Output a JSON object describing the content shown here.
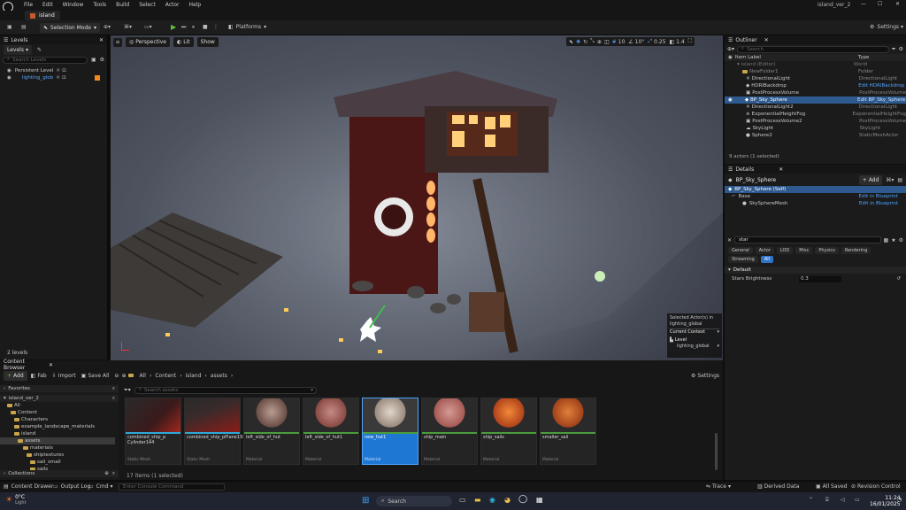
{
  "menu": {
    "items": [
      "File",
      "Edit",
      "Window",
      "Tools",
      "Build",
      "Select",
      "Actor",
      "Help"
    ],
    "project": "island_ver_2"
  },
  "tab": {
    "label": "island"
  },
  "toolbar": {
    "mode": "Selection Mode",
    "platforms": "Platforms",
    "settings": "Settings"
  },
  "levels": {
    "tab": "Levels",
    "dropdown": "Levels",
    "search_placeholder": "Search Levels",
    "items": [
      "Persistent Level",
      "lighting_glob"
    ],
    "count": "2 levels"
  },
  "viewport": {
    "perspective": "Perspective",
    "lit": "Lit",
    "show": "Show",
    "grid": "10",
    "angle": "10°",
    "scale": "0.25",
    "speed": "1.4",
    "overlay": {
      "line1": "Selected Actor(s) in",
      "line2": "lighting_global",
      "context": "Current Context",
      "level_label": "Level",
      "level_value": "lighting_global"
    }
  },
  "outliner": {
    "tab": "Outliner",
    "search_placeholder": "Search",
    "col_label": "Item Label",
    "col_type": "Type",
    "rows": [
      {
        "label": "island (Editor)",
        "type": "World"
      },
      {
        "label": "NewFolder1",
        "type": "Folder"
      },
      {
        "label": "DirectionalLight",
        "type": "DirectionalLight"
      },
      {
        "label": "HDRIBackdrop",
        "type": "Edit HDRIBackdrop"
      },
      {
        "label": "PostProcessVolume",
        "type": "PostProcessVolume"
      },
      {
        "label": "BP_Sky_Sphere",
        "type": "Edit BP_Sky_Sphere"
      },
      {
        "label": "DirectionalLight2",
        "type": "DirectionalLight"
      },
      {
        "label": "ExponentialHeightFog",
        "type": "ExponentialHeightFog"
      },
      {
        "label": "PostProcessVolume2",
        "type": "PostProcessVolume"
      },
      {
        "label": "SkyLight",
        "type": "SkyLight"
      },
      {
        "label": "Sphere2",
        "type": "StaticMeshActor"
      }
    ],
    "footer": "9 actors (1 selected)"
  },
  "details": {
    "tab": "Details",
    "actor": "BP_Sky_Sphere",
    "add": "Add",
    "self": "BP_Sky_Sphere (Self)",
    "comp1": "Base",
    "comp1_link": "Edit in Blueprint",
    "comp2": "SkySphereMesh",
    "comp2_link": "Edit in Blueprint",
    "filter": "star",
    "tabs": [
      "General",
      "Actor",
      "LOD",
      "Misc",
      "Physics",
      "Rendering",
      "Streaming",
      "All"
    ],
    "section": "Default",
    "prop_label": "Stars Brightness",
    "prop_value": "0.3"
  },
  "content": {
    "tab": "Content Browser",
    "add": "Add",
    "fab": "Fab",
    "import": "Import",
    "save_all": "Save All",
    "path": [
      "All",
      "Content",
      "island",
      "assets"
    ],
    "settings": "Settings",
    "favorites": "Favorites",
    "project": "island_ver_2",
    "search_placeholder": "Search assets",
    "collections": "Collections",
    "footer": "17 items (1 selected)",
    "tree": [
      "All",
      "Content",
      "Characters",
      "example_landscape_materials",
      "island",
      "assets",
      "materials",
      "shiptextures",
      "sail_small",
      "sails"
    ],
    "assets": [
      {
        "name": "combined_ship_p Cylinder144",
        "type": "Static Mesh"
      },
      {
        "name": "combined_ship_pPlane193",
        "type": "Static Mesh"
      },
      {
        "name": "left_side_of_hut",
        "type": "Material"
      },
      {
        "name": "left_side_of_hut1",
        "type": "Material"
      },
      {
        "name": "new_hut1",
        "type": "Material"
      },
      {
        "name": "ship_main",
        "type": "Material"
      },
      {
        "name": "ship_sails",
        "type": "Material"
      },
      {
        "name": "smaller_sail",
        "type": "Material"
      }
    ]
  },
  "statusbar": {
    "drawer": "Content Drawer",
    "output": "Output Log",
    "cmd": "Cmd",
    "console_placeholder": "Enter Console Command",
    "trace": "Trace",
    "derived": "Derived Data",
    "saved": "All Saved",
    "revision": "Revision Control"
  },
  "taskbar": {
    "temp": "0°C",
    "weather": "Light",
    "search": "Search",
    "time": "11:24",
    "date": "16/01/2025"
  }
}
